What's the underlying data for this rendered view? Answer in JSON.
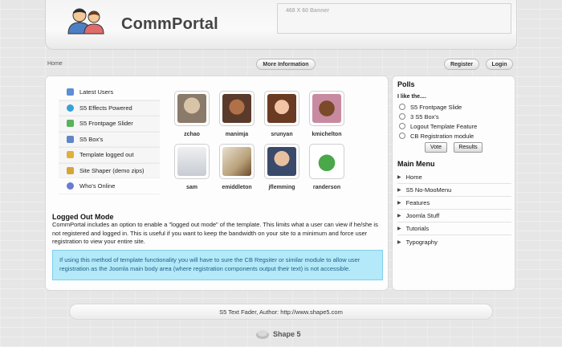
{
  "header": {
    "logo_text": "CommPortal",
    "banner_text": "468 X 60 Banner"
  },
  "breadcrumb": {
    "home": "Home"
  },
  "toolbar": {
    "more_info": "More Information",
    "register": "Register",
    "login": "Login"
  },
  "tabs": [
    {
      "label": "Latest Users",
      "icon": "users-icon",
      "color": "#5b8fd6"
    },
    {
      "label": "S5 Effects Powered",
      "icon": "effects-icon",
      "color": "#3aa0d8"
    },
    {
      "label": "S5 Frontpage Slider",
      "icon": "slider-icon",
      "color": "#57b35c"
    },
    {
      "label": "S5 Box's",
      "icon": "boxes-icon",
      "color": "#5f86c8"
    },
    {
      "label": "Template logged out",
      "icon": "lock-icon",
      "color": "#e0b03a"
    },
    {
      "label": "Site Shaper (demo zips)",
      "icon": "download-icon",
      "color": "#d4a53b"
    },
    {
      "label": "Who's Online",
      "icon": "online-icon",
      "color": "#6a7bd0"
    }
  ],
  "users": [
    {
      "name": "zchao",
      "color": "#8a7a6a"
    },
    {
      "name": "manimja",
      "color": "#a85a3a"
    },
    {
      "name": "srunyan",
      "color": "#c98a6a"
    },
    {
      "name": "kmichelton",
      "color": "#7a4a2a"
    },
    {
      "name": "sam",
      "color": "#9aa0a8"
    },
    {
      "name": "emiddleton",
      "color": "#b8a07a"
    },
    {
      "name": "jflemming",
      "color": "#c8a488"
    },
    {
      "name": "randerson",
      "color": "#4aa84a"
    }
  ],
  "content": {
    "title": "Logged Out Mode",
    "body": "CommPortal includes an option to enable a \"logged out mode\" of the template. This limits what a user can view if he/she is not registered and logged in. This is useful if you want to keep the bandwidth on your site to a minimum and force user registration to view your entire site.",
    "notice": "If using this method of template functionality you will have to sure the CB Regsiter or similar module to allow user registration as the Joomla main body area (where registration components output their text) is not accessible."
  },
  "polls": {
    "title": "Polls",
    "question": "I like the....",
    "options": [
      "S5 Frontpage Slide",
      "3 S5 Box's",
      "Logout Template Feature",
      "CB Registration module"
    ],
    "vote": "Vote",
    "results": "Results"
  },
  "main_menu": {
    "title": "Main Menu",
    "items": [
      "Home",
      "S5 No-MooMenu",
      "Features",
      "Joomla Stuff",
      "Tutorials",
      "Typography"
    ]
  },
  "footer": {
    "credit": "S5 Text Fader, Author: http://www.shape5.com",
    "brand": "Shape 5"
  }
}
